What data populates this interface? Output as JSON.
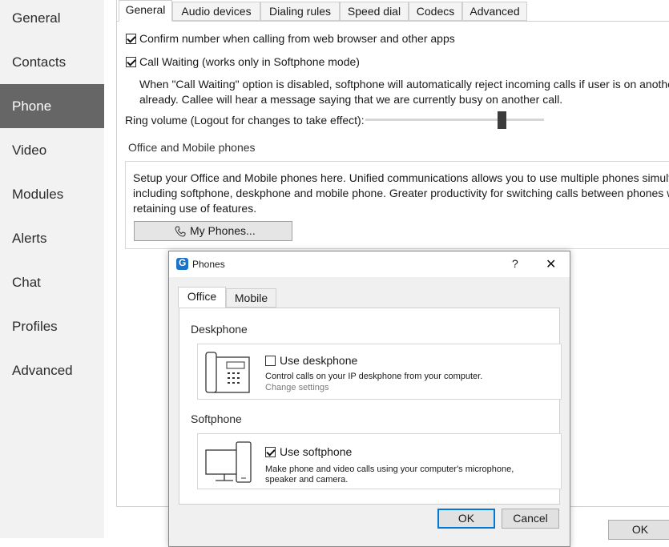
{
  "sidebar": {
    "items": [
      {
        "label": "General"
      },
      {
        "label": "Contacts"
      },
      {
        "label": "Phone",
        "active": true
      },
      {
        "label": "Video"
      },
      {
        "label": "Modules"
      },
      {
        "label": "Alerts"
      },
      {
        "label": "Chat"
      },
      {
        "label": "Profiles"
      },
      {
        "label": "Advanced"
      }
    ]
  },
  "tabs": [
    {
      "label": "General",
      "active": true
    },
    {
      "label": "Audio devices"
    },
    {
      "label": "Dialing rules"
    },
    {
      "label": "Speed dial"
    },
    {
      "label": "Codecs"
    },
    {
      "label": "Advanced"
    }
  ],
  "general": {
    "confirm_number": {
      "label": "Confirm number when calling from web browser and other apps",
      "checked": true
    },
    "call_waiting": {
      "label": "Call Waiting (works only in Softphone mode)",
      "checked": true
    },
    "call_waiting_note_line1": "When \"Call Waiting\" option is disabled, softphone will automatically reject incoming calls if user is on another",
    "call_waiting_note_line2": "already. Callee will hear a message saying that we are currently busy on another call.",
    "ring_volume_label": "Ring volume (Logout for changes to take effect):",
    "ring_volume_level": 0.78,
    "office_mobile_heading": "Office and Mobile phones",
    "office_mobile_desc_line1": "Setup your Office and Mobile phones here. Unified communications allows you to use multiple phones simulta",
    "office_mobile_desc_line2": "including softphone, deskphone and mobile phone. Greater productivity for switching calls between phones w",
    "office_mobile_desc_line3": "retaining use of features.",
    "my_phones_button": "My Phones...",
    "ok_button": "OK"
  },
  "dialog": {
    "title": "Phones",
    "help": "?",
    "close": "✕",
    "tabs": [
      {
        "label": "Office",
        "active": true
      },
      {
        "label": "Mobile"
      }
    ],
    "deskphone_heading": "Deskphone",
    "deskphone": {
      "label": "Use deskphone",
      "checked": false,
      "desc": "Control calls on your IP deskphone from your computer.",
      "link": "Change settings"
    },
    "softphone_heading": "Softphone",
    "softphone": {
      "label": "Use softphone",
      "checked": true,
      "desc_line1": "Make phone and video calls using your computer's microphone,",
      "desc_line2": "speaker and camera."
    },
    "ok_button": "OK",
    "cancel_button": "Cancel"
  }
}
